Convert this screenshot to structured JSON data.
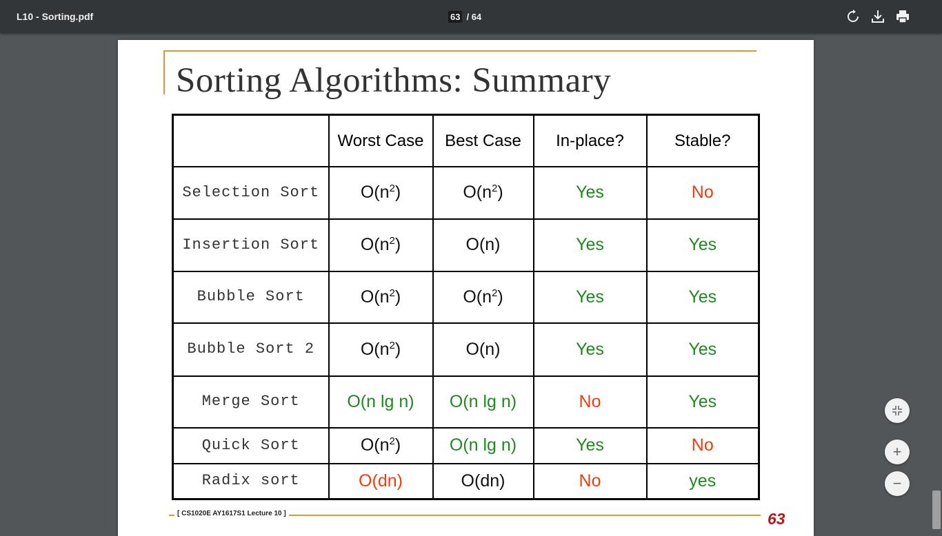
{
  "toolbar": {
    "title": "L10 - Sorting.pdf",
    "current_page": "63",
    "total_pages": "/ 64",
    "icons": [
      "rotate-icon",
      "download-icon",
      "print-icon"
    ]
  },
  "slide": {
    "title": "Sorting Algorithms: Summary",
    "footer": "[ CS1020E AY1617S1 Lecture 10 ]",
    "page_number": "63",
    "columns": [
      "",
      "Worst Case",
      "Best Case",
      "In-place?",
      "Stable?"
    ],
    "rows": [
      {
        "name": "Selection Sort",
        "worst": "O(n²)",
        "best": "O(n²)",
        "inplace": "Yes",
        "stable": "No"
      },
      {
        "name": "Insertion Sort",
        "worst": "O(n²)",
        "best": "O(n)",
        "inplace": "Yes",
        "stable": "Yes"
      },
      {
        "name": "Bubble Sort",
        "worst": "O(n²)",
        "best": "O(n²)",
        "inplace": "Yes",
        "stable": "Yes"
      },
      {
        "name": "Bubble Sort 2",
        "worst": "O(n²)",
        "best": "O(n)",
        "inplace": "Yes",
        "stable": "Yes"
      },
      {
        "name": "Merge Sort",
        "worst": "O(n lg n)",
        "best": "O(n lg n)",
        "inplace": "No",
        "stable": "Yes"
      },
      {
        "name": "Quick Sort",
        "worst": "O(n²)",
        "best": "O(n lg n)",
        "inplace": "Yes",
        "stable": "No"
      },
      {
        "name": "Radix sort",
        "worst": "O(dn)",
        "best": "O(dn)",
        "inplace": "No",
        "stable": "yes"
      }
    ],
    "colors": {
      "green": "#1e8a1e",
      "red": "#ee3d0d",
      "accent_rule": "#d89a2c",
      "page_number": "#b01a1a"
    }
  },
  "zoom_controls": {
    "fit_icon": "fit-to-page-icon",
    "zoom_in_label": "+",
    "zoom_out_label": "−"
  }
}
